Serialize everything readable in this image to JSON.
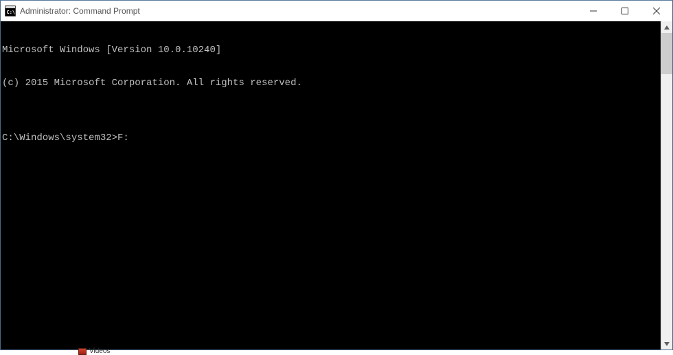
{
  "titlebar": {
    "title": "Administrator: Command Prompt"
  },
  "terminal": {
    "line1": "Microsoft Windows [Version 10.0.10240]",
    "line2": "(c) 2015 Microsoft Corporation. All rights reserved.",
    "blank": "",
    "prompt": "C:\\Windows\\system32>F:"
  },
  "remnant": {
    "label": "Videos"
  }
}
